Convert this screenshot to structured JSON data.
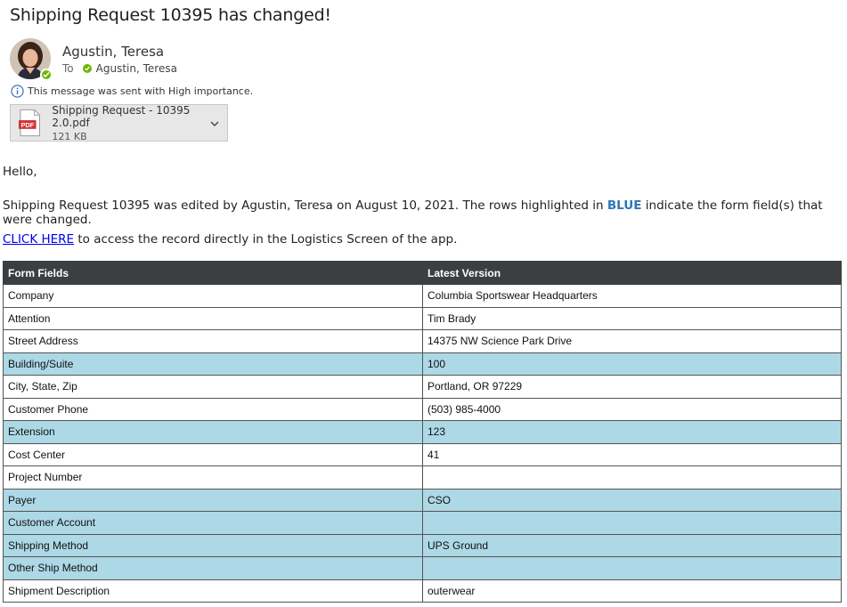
{
  "email": {
    "subject": "Shipping Request 10395 has changed!",
    "sender": "Agustin, Teresa",
    "to_label": "To",
    "recipient": "Agustin, Teresa",
    "importance_note": "This message was sent with High importance.",
    "attachment": {
      "name": "Shipping Request - 10395 2.0.pdf",
      "size": "121 KB",
      "type_label": "PDF"
    }
  },
  "body": {
    "greeting": "Hello,",
    "edited_prefix": "Shipping Request 10395 was edited by Agustin, Teresa on August 10, 2021. The rows highlighted in ",
    "highlight_word": "BLUE",
    "edited_suffix": " indicate the form field(s) that were changed.",
    "link_text": "CLICK HERE",
    "link_suffix": " to access the record directly in the Logistics Screen of the app."
  },
  "colors": {
    "highlight": "#add8e6",
    "header_bg": "#3b3f42",
    "presence_green": "#6bb700",
    "link": "#0000ee",
    "blue_word": "#2e75b6"
  },
  "table": {
    "headers": [
      "Form Fields",
      "Latest Version"
    ],
    "rows": [
      {
        "field": "Company",
        "value": "Columbia Sportswear Headquarters",
        "changed": false
      },
      {
        "field": "Attention",
        "value": "Tim Brady",
        "changed": false
      },
      {
        "field": "Street Address",
        "value": "14375 NW Science Park Drive",
        "changed": false
      },
      {
        "field": "Building/Suite",
        "value": "100",
        "changed": true
      },
      {
        "field": "City, State, Zip",
        "value": "Portland, OR 97229",
        "changed": false
      },
      {
        "field": "Customer Phone",
        "value": "(503) 985-4000",
        "changed": false
      },
      {
        "field": "Extension",
        "value": "123",
        "changed": true
      },
      {
        "field": "Cost Center",
        "value": "41",
        "changed": false
      },
      {
        "field": "Project Number",
        "value": "",
        "changed": false
      },
      {
        "field": "Payer",
        "value": "CSO",
        "changed": true
      },
      {
        "field": "Customer Account",
        "value": "",
        "changed": true
      },
      {
        "field": "Shipping Method",
        "value": "UPS Ground",
        "changed": true
      },
      {
        "field": "Other Ship Method",
        "value": "",
        "changed": true
      },
      {
        "field": "Shipment Description",
        "value": "outerwear",
        "changed": false
      }
    ]
  }
}
